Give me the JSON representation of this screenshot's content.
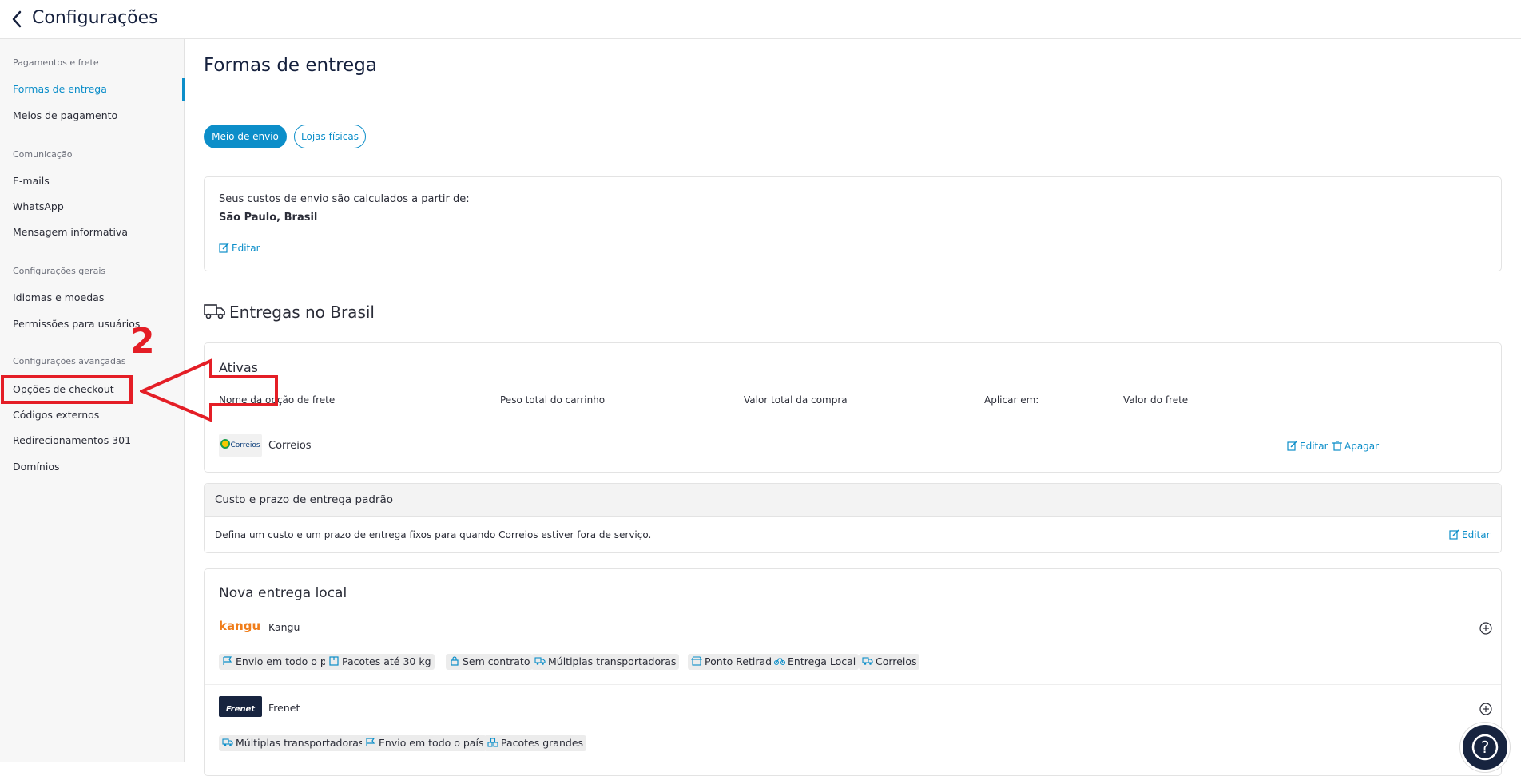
{
  "header": {
    "title": "Configurações"
  },
  "sidebar": {
    "sections": [
      {
        "title": "Pagamentos e frete",
        "items": [
          "Formas de entrega",
          "Meios de pagamento"
        ]
      },
      {
        "title": "Comunicação",
        "items": [
          "E-mails",
          "WhatsApp",
          "Mensagem informativa"
        ]
      },
      {
        "title": "Configurações gerais",
        "items": [
          "Idiomas e moedas",
          "Permissões para usuários"
        ]
      },
      {
        "title": "Configurações avançadas",
        "items": [
          "Opções de checkout",
          "Códigos externos",
          "Redirecionamentos 301",
          "Domínios"
        ]
      }
    ],
    "active_item": "Formas de entrega"
  },
  "annotation": {
    "step_number": "2",
    "color": "#e41e26"
  },
  "main": {
    "title": "Formas de entrega",
    "tabs": [
      {
        "label": "Meio de envio",
        "active": true
      },
      {
        "label": "Lojas físicas",
        "active": false
      }
    ],
    "origin_card": {
      "text": "Seus custos de envio são calculados a partir de:",
      "location": "São Paulo, Brasil",
      "edit_label": "Editar"
    },
    "brazil": {
      "title": "Entregas no Brasil",
      "active_card": {
        "title": "Ativas",
        "columns": [
          "Nome da opção de frete",
          "Peso total do carrinho",
          "Valor total da compra",
          "Aplicar em:",
          "Valor do frete"
        ],
        "row": {
          "logo_text": "Correios",
          "name": "Correios",
          "edit_label": "Editar",
          "delete_label": "Apagar"
        }
      },
      "default_card": {
        "title": "Custo e prazo de entrega padrão",
        "text": "Defina um custo e um prazo de entrega fixos para quando Correios estiver fora de serviço.",
        "edit_label": "Editar"
      }
    },
    "local": {
      "title": "Nova entrega local",
      "providers": [
        {
          "name": "Kangu",
          "logo_text": "kangu",
          "tags": [
            "Envio em todo o país",
            "Pacotes até 30 kg",
            "Sem contrato",
            "Múltiplas transportadoras",
            "Ponto Retirada",
            "Entrega Local",
            "Correios"
          ]
        },
        {
          "name": "Frenet",
          "logo_text": "Frenet",
          "tags": [
            "Múltiplas transportadoras",
            "Envio em todo o país",
            "Pacotes grandes"
          ]
        }
      ]
    }
  },
  "help_label": "?",
  "colors": {
    "accent": "#0c8ec9",
    "annotation": "#e41e26",
    "dark": "#17243f"
  }
}
